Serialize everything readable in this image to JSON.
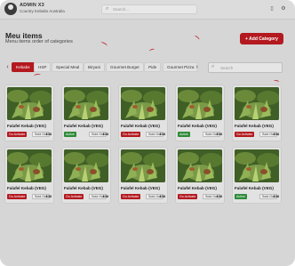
{
  "topbar": {
    "brand_name": "ADMIN X3",
    "brand_sub": "Country Kebabs Australia",
    "search_placeholder": "Search..."
  },
  "header": {
    "title": "Meu items",
    "subtitle": "Menu items order of categories",
    "add_button_label": "+ Add Category"
  },
  "tabs": [
    {
      "label": "Kebabs",
      "active": true
    },
    {
      "label": "HSP",
      "active": false
    },
    {
      "label": "Special Meal",
      "active": false
    },
    {
      "label": "Biryani",
      "active": false
    },
    {
      "label": "Gourmet Burger",
      "active": false
    },
    {
      "label": "Pide",
      "active": false
    },
    {
      "label": "Gourmet Pizza",
      "active": false
    }
  ],
  "search": {
    "placeholder": "Search"
  },
  "items": [
    {
      "title": "Falafel Kebab (VEG)",
      "status": "Go Activate",
      "status_type": "inactive",
      "soldout": "Sold Out",
      "price": "$38"
    },
    {
      "title": "Falafel Kebab (VEG)",
      "status": "Active",
      "status_type": "active",
      "soldout": "Sold Out",
      "price": "$38"
    },
    {
      "title": "Falafel Kebab (VEG)",
      "status": "Go Activate",
      "status_type": "inactive",
      "soldout": "Sold Out",
      "price": "$38"
    },
    {
      "title": "Falafel Kebab (VEG)",
      "status": "Active",
      "status_type": "active",
      "soldout": "Sold Out",
      "price": "$38"
    },
    {
      "title": "Falafel Kebab (VEG)",
      "status": "Go Activate",
      "status_type": "inactive",
      "soldout": "Sold Out",
      "price": "$38"
    },
    {
      "title": "Falafel Kebab (VEG)",
      "status": "Go Activate",
      "status_type": "inactive",
      "soldout": "Sold Out",
      "price": "$38"
    },
    {
      "title": "Falafel Kebab (VEG)",
      "status": "Go Activate",
      "status_type": "inactive",
      "soldout": "Sold Out",
      "price": "$38"
    },
    {
      "title": "Falafel Kebab (VEG)",
      "status": "Go Activate",
      "status_type": "inactive",
      "soldout": "Sold Out",
      "price": "$38"
    },
    {
      "title": "Falafel Kebab (VEG)",
      "status": "Go Activate",
      "status_type": "inactive",
      "soldout": "Sold Out",
      "price": "$38"
    },
    {
      "title": "Falafel Kebab (VEG)",
      "status": "Active",
      "status_type": "active",
      "soldout": "Sold Out",
      "price": "$38"
    }
  ],
  "colors": {
    "accent": "#b3191f",
    "active_green": "#2e8b3a",
    "background": "#d6d6d6"
  },
  "icons": {
    "search": "search-icon",
    "bell": "bell-icon",
    "settings": "gear-icon",
    "prev": "chevron-left-icon",
    "next": "chevron-right-icon"
  }
}
